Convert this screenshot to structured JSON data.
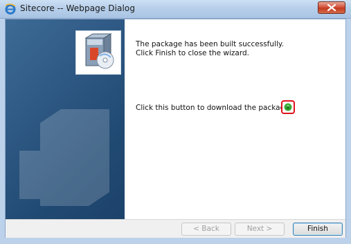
{
  "window": {
    "title": "Sitecore -- Webpage Dialog",
    "title_icon": "ie-icon",
    "close_icon": "close-icon"
  },
  "sidebar": {
    "logo_icon": "package-box-icon",
    "colors": {
      "top": "#3d6b95",
      "bottom": "#1c426a"
    }
  },
  "content": {
    "message_line1": "The package has been built successfully.",
    "message_line2": "Click Finish to close the wizard.",
    "download_label": "Click this button to download the package:",
    "download_icon": "download-package-icon",
    "highlight_color": "#e0101a"
  },
  "footer": {
    "back_label": "< Back",
    "next_label": "Next >",
    "finish_label": "Finish"
  }
}
